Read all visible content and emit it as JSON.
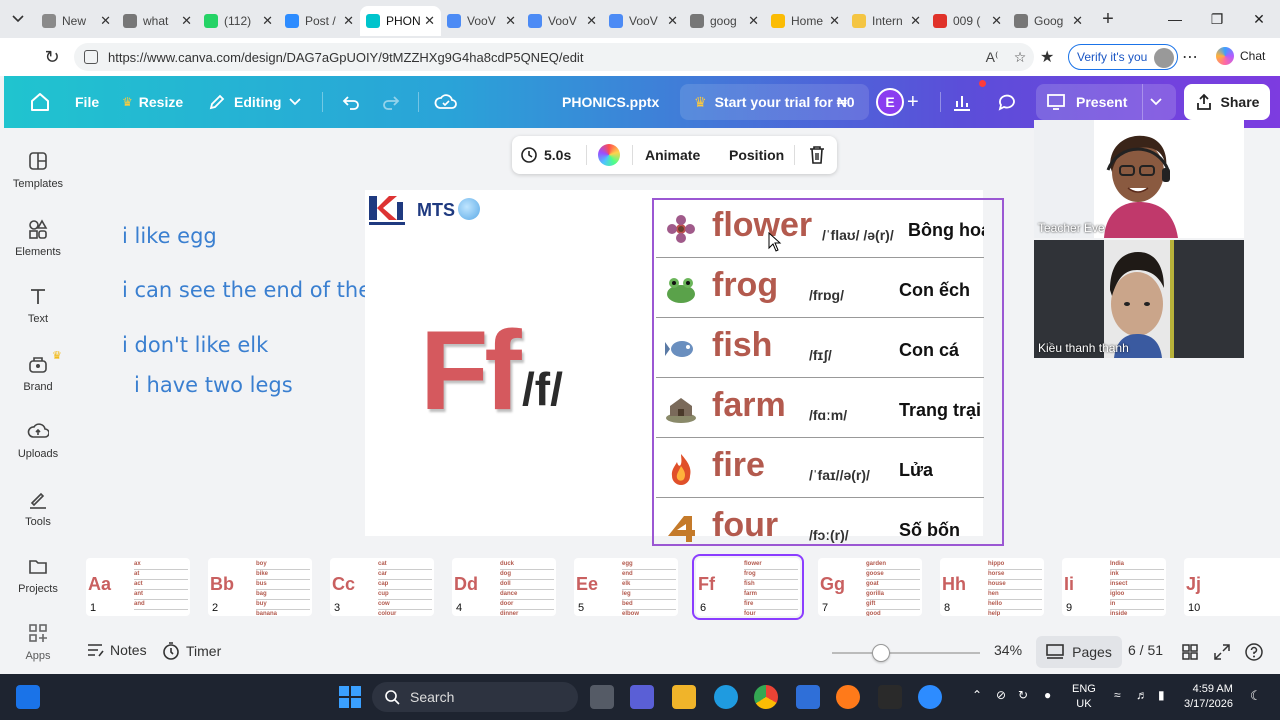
{
  "browser": {
    "tabs": [
      {
        "title": "New",
        "fav_color": "#8a8a8a",
        "active": false
      },
      {
        "title": "what",
        "fav_color": "#777777",
        "active": false
      },
      {
        "title": "(112)",
        "fav_color": "#25d366",
        "active": false
      },
      {
        "title": "Post /",
        "fav_color": "#2d8cff",
        "active": false
      },
      {
        "title": "PHON",
        "fav_color": "#00c4cc",
        "active": true
      },
      {
        "title": "VooV",
        "fav_color": "#4c8bf5",
        "active": false
      },
      {
        "title": "VooV",
        "fav_color": "#4c8bf5",
        "active": false
      },
      {
        "title": "VooV",
        "fav_color": "#4c8bf5",
        "active": false
      },
      {
        "title": "goog",
        "fav_color": "#777777",
        "active": false
      },
      {
        "title": "Home",
        "fav_color": "#fbbc04",
        "active": false
      },
      {
        "title": "Intern",
        "fav_color": "#f4c542",
        "active": false
      },
      {
        "title": "009 (",
        "fav_color": "#e0322a",
        "active": false
      },
      {
        "title": "Goog",
        "fav_color": "#777777",
        "active": false
      }
    ],
    "url": "https://www.canva.com/design/DAG7aGpUOIY/9tMZZHXg9G4ha8cdP5QNEQ/edit",
    "verify_label": "Verify it's you",
    "chat_label": "Chat"
  },
  "canva": {
    "file_label": "File",
    "resize_label": "Resize",
    "editing_label": "Editing",
    "doc_title": "PHONICS.pptx",
    "trial_label": "Start your trial for ₦0",
    "avatar_letter": "E",
    "present_label": "Present",
    "share_label": "Share",
    "sidebar": [
      {
        "label": "Templates",
        "icon": "templates-icon"
      },
      {
        "label": "Elements",
        "icon": "elements-icon"
      },
      {
        "label": "Text",
        "icon": "text-icon"
      },
      {
        "label": "Brand",
        "icon": "brand-icon"
      },
      {
        "label": "Uploads",
        "icon": "uploads-icon"
      },
      {
        "label": "Tools",
        "icon": "tools-icon"
      },
      {
        "label": "Projects",
        "icon": "projects-icon"
      },
      {
        "label": "Apps",
        "icon": "apps-icon"
      }
    ],
    "floating_toolbar": {
      "duration": "5.0s",
      "animate_label": "Animate",
      "position_label": "Position"
    },
    "canvas_text": [
      "i like egg",
      "i can see the end of the rope",
      "i don't like elk",
      "i have two legs"
    ],
    "slide": {
      "logo_text": "MTS",
      "big_letters": "Ff",
      "phoneme": "/f/",
      "words": [
        {
          "word": "flower",
          "ipa": "/ˈflaʊ/ /ə(r)/",
          "meaning": "Bông hoa"
        },
        {
          "word": "frog",
          "ipa": "/frɒg/",
          "meaning": "Con ếch"
        },
        {
          "word": "fish",
          "ipa": "/fɪʃ/",
          "meaning": "Con cá"
        },
        {
          "word": "farm",
          "ipa": "/fɑːm/",
          "meaning": "Trang trại"
        },
        {
          "word": "fire",
          "ipa": "/ˈfaɪ//ə(r)/",
          "meaning": "Lửa"
        },
        {
          "word": "four",
          "ipa": "/fɔː(r)/",
          "meaning": "Số bốn"
        }
      ]
    },
    "video_tiles": [
      {
        "name": "Teacher Eve"
      },
      {
        "name": "Kiều thanh thanh"
      }
    ],
    "thumbnails": [
      {
        "num": "1",
        "letter": "Aa",
        "words": [
          "ax",
          "at",
          "act",
          "ant",
          "and"
        ]
      },
      {
        "num": "2",
        "letter": "Bb",
        "words": [
          "boy",
          "bike",
          "bus",
          "bag",
          "buy",
          "banana"
        ]
      },
      {
        "num": "3",
        "letter": "Cc",
        "words": [
          "cat",
          "car",
          "cap",
          "cup",
          "cow",
          "colour"
        ]
      },
      {
        "num": "4",
        "letter": "Dd",
        "words": [
          "duck",
          "dog",
          "doll",
          "dance",
          "door",
          "dinner"
        ]
      },
      {
        "num": "5",
        "letter": "Ee",
        "words": [
          "egg",
          "end",
          "elk",
          "leg",
          "bed",
          "elbow"
        ]
      },
      {
        "num": "6",
        "letter": "Ff",
        "words": [
          "flower",
          "frog",
          "fish",
          "farm",
          "fire",
          "four"
        ],
        "active": true
      },
      {
        "num": "7",
        "letter": "Gg",
        "words": [
          "garden",
          "goose",
          "goat",
          "gorilla",
          "gift",
          "good"
        ]
      },
      {
        "num": "8",
        "letter": "Hh",
        "words": [
          "hippo",
          "horse",
          "house",
          "hen",
          "hello",
          "help"
        ]
      },
      {
        "num": "9",
        "letter": "Ii",
        "words": [
          "India",
          "ink",
          "insect",
          "igloo",
          "in",
          "inside"
        ]
      },
      {
        "num": "10",
        "letter": "Jj",
        "words": []
      }
    ],
    "bottom": {
      "notes_label": "Notes",
      "timer_label": "Timer",
      "zoom": "34%",
      "pages_label": "Pages",
      "page_count": "6 / 51"
    }
  },
  "taskbar": {
    "search_label": "Search",
    "lang_top": "ENG",
    "lang_bottom": "UK",
    "time": "4:59 AM",
    "date": "3/17/2026"
  }
}
